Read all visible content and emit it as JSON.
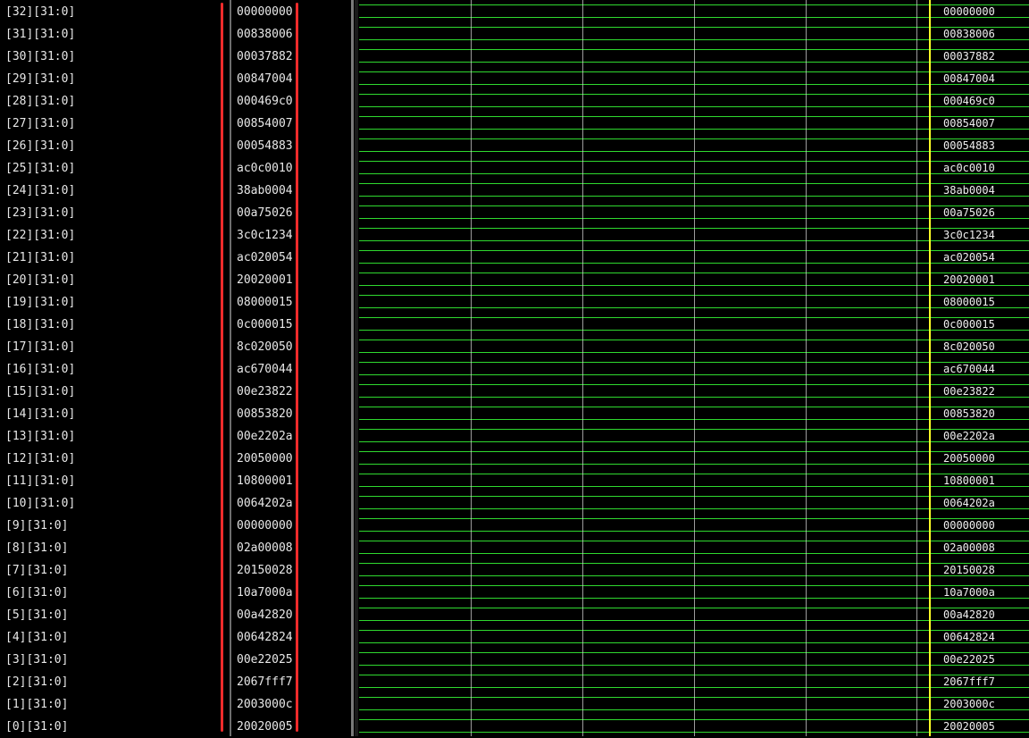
{
  "signals": [
    {
      "name": "[32][31:0]",
      "value": "00000000"
    },
    {
      "name": "[31][31:0]",
      "value": "00838006"
    },
    {
      "name": "[30][31:0]",
      "value": "00037882"
    },
    {
      "name": "[29][31:0]",
      "value": "00847004"
    },
    {
      "name": "[28][31:0]",
      "value": "000469c0"
    },
    {
      "name": "[27][31:0]",
      "value": "00854007"
    },
    {
      "name": "[26][31:0]",
      "value": "00054883"
    },
    {
      "name": "[25][31:0]",
      "value": "ac0c0010"
    },
    {
      "name": "[24][31:0]",
      "value": "38ab0004"
    },
    {
      "name": "[23][31:0]",
      "value": "00a75026"
    },
    {
      "name": "[22][31:0]",
      "value": "3c0c1234"
    },
    {
      "name": "[21][31:0]",
      "value": "ac020054"
    },
    {
      "name": "[20][31:0]",
      "value": "20020001"
    },
    {
      "name": "[19][31:0]",
      "value": "08000015"
    },
    {
      "name": "[18][31:0]",
      "value": "0c000015"
    },
    {
      "name": "[17][31:0]",
      "value": "8c020050"
    },
    {
      "name": "[16][31:0]",
      "value": "ac670044"
    },
    {
      "name": "[15][31:0]",
      "value": "00e23822"
    },
    {
      "name": "[14][31:0]",
      "value": "00853820"
    },
    {
      "name": "[13][31:0]",
      "value": "00e2202a"
    },
    {
      "name": "[12][31:0]",
      "value": "20050000"
    },
    {
      "name": "[11][31:0]",
      "value": "10800001"
    },
    {
      "name": "[10][31:0]",
      "value": "0064202a"
    },
    {
      "name": "[9][31:0]",
      "value": "00000000"
    },
    {
      "name": "[8][31:0]",
      "value": "02a00008"
    },
    {
      "name": "[7][31:0]",
      "value": "20150028"
    },
    {
      "name": "[6][31:0]",
      "value": "10a7000a"
    },
    {
      "name": "[5][31:0]",
      "value": "00a42820"
    },
    {
      "name": "[4][31:0]",
      "value": "00642824"
    },
    {
      "name": "[3][31:0]",
      "value": "00e22025"
    },
    {
      "name": "[2][31:0]",
      "value": "2067fff7"
    },
    {
      "name": "[1][31:0]",
      "value": "2003000c"
    },
    {
      "name": "[0][31:0]",
      "value": "20020005"
    }
  ],
  "colors": {
    "waveform": "#2fd92f",
    "cursor": "#ffff26",
    "annotation": "#ef2b2b",
    "background": "#000000"
  }
}
